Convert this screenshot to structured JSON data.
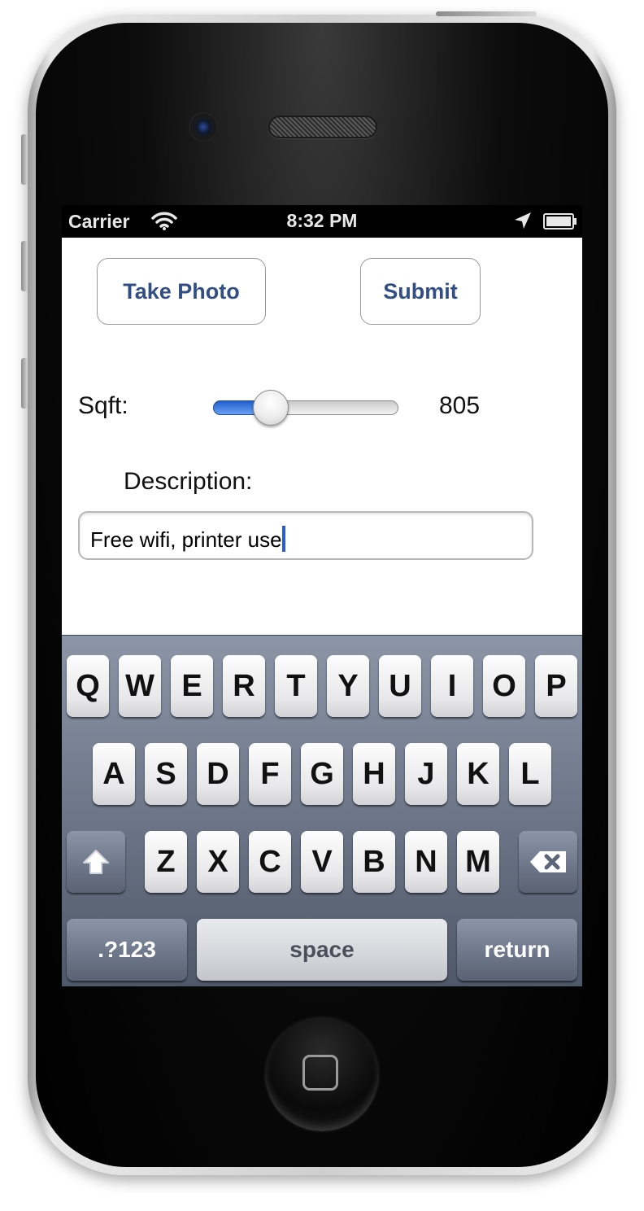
{
  "status_bar": {
    "carrier": "Carrier",
    "time": "8:32 PM",
    "icons": [
      "wifi-icon",
      "location-arrow-icon",
      "battery-icon"
    ]
  },
  "form": {
    "take_photo_label": "Take Photo",
    "submit_label": "Submit",
    "sqft_label": "Sqft:",
    "sqft_value": "805",
    "slider_fraction": 0.31,
    "description_label": "Description:",
    "description_value": "Free wifi, printer use"
  },
  "keyboard": {
    "row1": [
      "Q",
      "W",
      "E",
      "R",
      "T",
      "Y",
      "U",
      "I",
      "O",
      "P"
    ],
    "row2": [
      "A",
      "S",
      "D",
      "F",
      "G",
      "H",
      "J",
      "K",
      "L"
    ],
    "row3": [
      "Z",
      "X",
      "C",
      "V",
      "B",
      "N",
      "M"
    ],
    "numbers_label": ".?123",
    "space_label": "space",
    "return_label": "return"
  },
  "colors": {
    "button_text": "#324f85",
    "slider_fill": "#2a6ae0",
    "cursor": "#2a5ad8"
  }
}
